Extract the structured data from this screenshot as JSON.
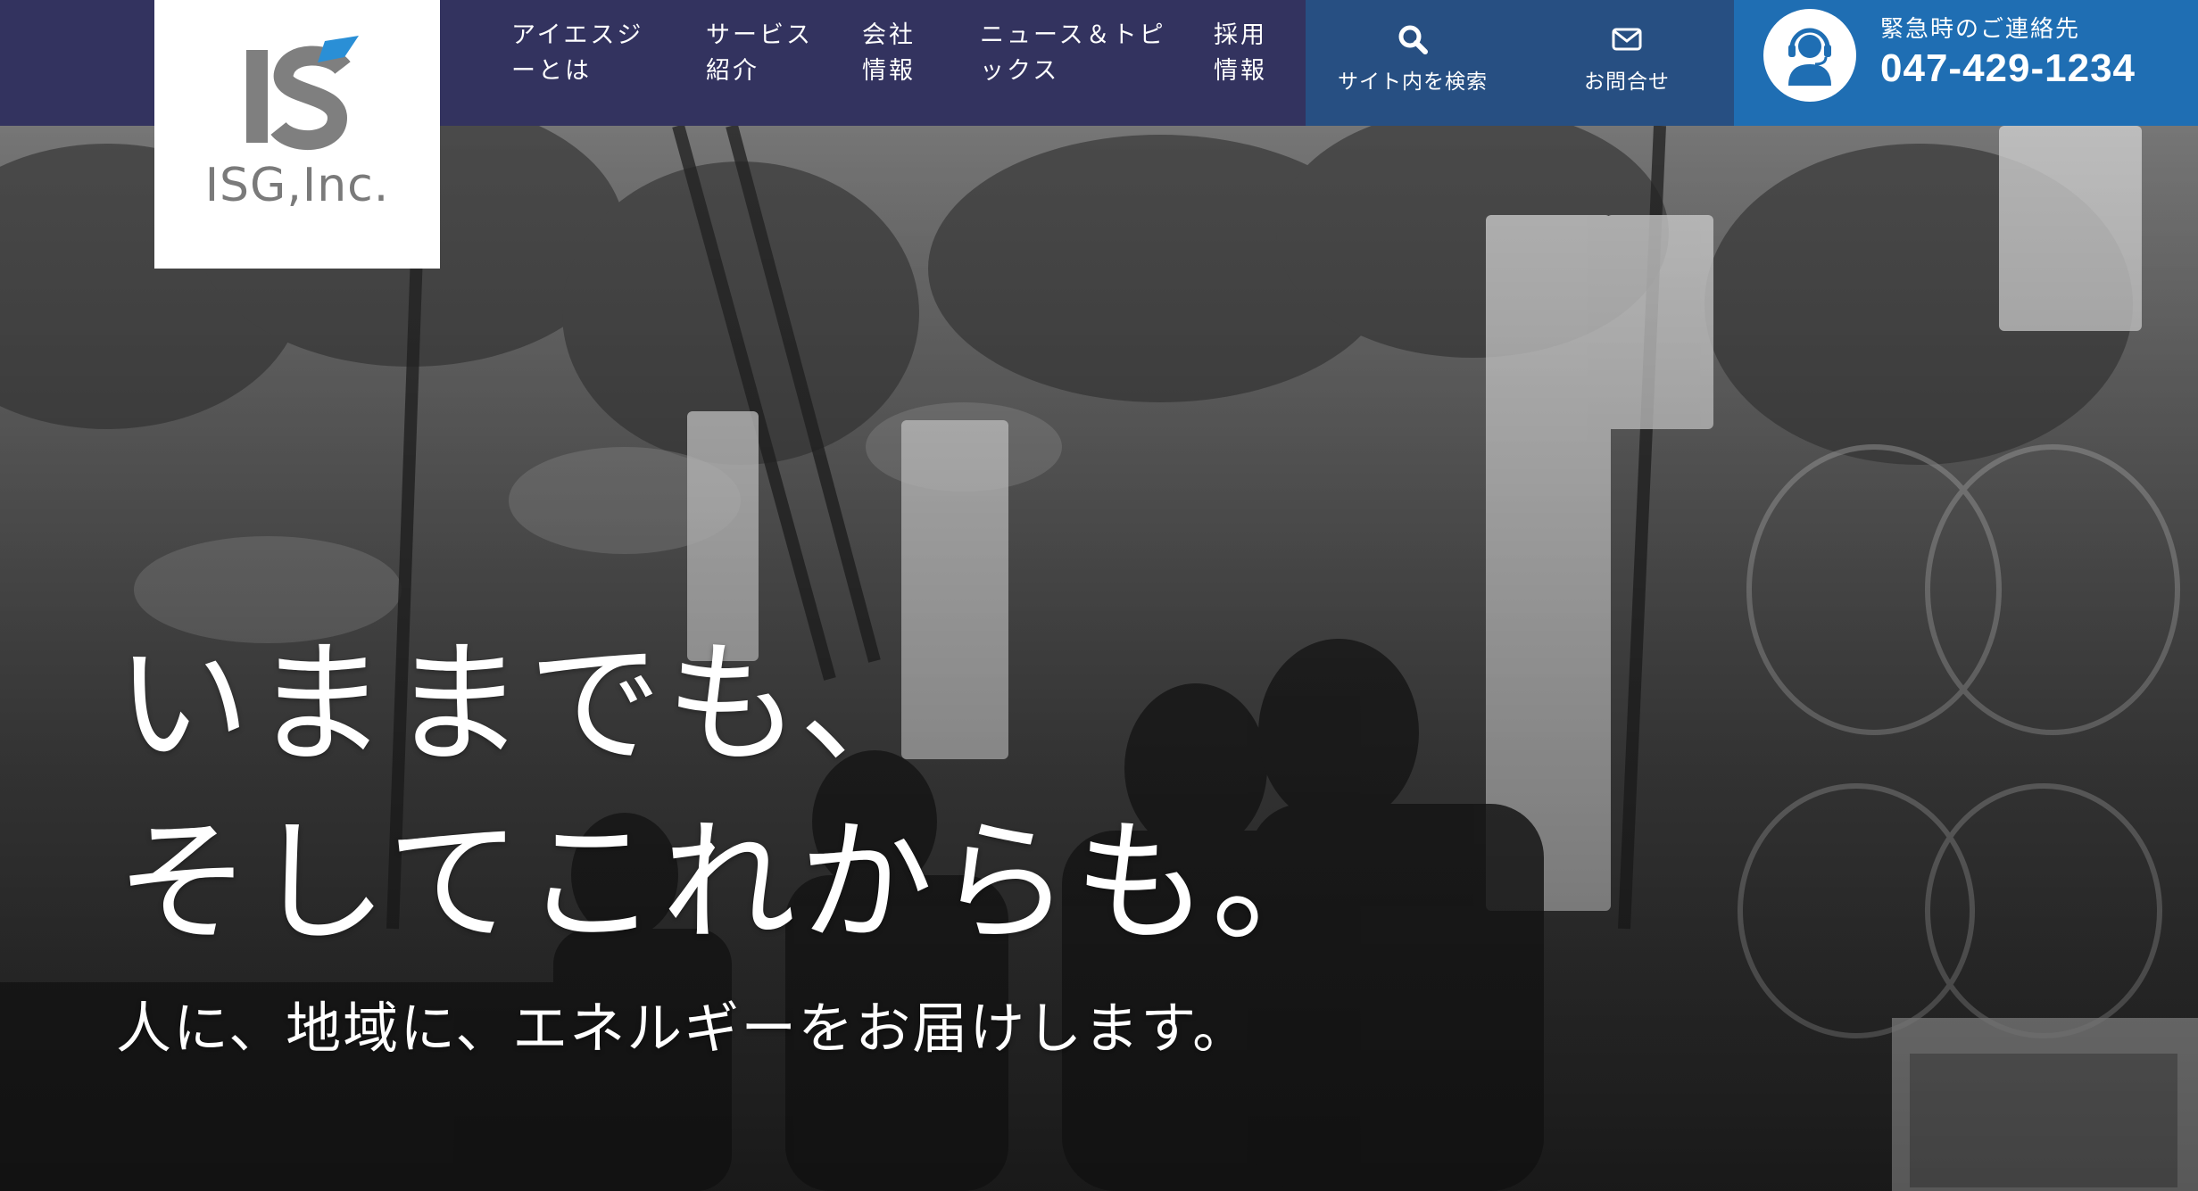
{
  "brand": {
    "logo_text": "ISG,Inc.",
    "logo_mark_letters": "IS",
    "colors": {
      "header": "#33335f",
      "utility": "#274f82",
      "emergency": "#1f6eb3"
    }
  },
  "nav": {
    "items": [
      {
        "line1": "アイエスジ",
        "line2": "ーとは"
      },
      {
        "line1": "サービス",
        "line2": "紹介"
      },
      {
        "line1": "会社",
        "line2": "情報"
      },
      {
        "line1": "ニュース＆トピ",
        "line2": "ックス"
      },
      {
        "line1": "採用",
        "line2": "情報"
      }
    ]
  },
  "utility": {
    "search": {
      "label": "サイト内を検索",
      "icon": "search-icon"
    },
    "contact": {
      "label": "お問合せ",
      "icon": "envelope-icon"
    }
  },
  "emergency": {
    "label": "緊急時のご連絡先",
    "phone": "047-429-1234",
    "icon": "operator-headset-icon"
  },
  "hero": {
    "headline_line1": "いままでも、",
    "headline_line2": "そしてこれからも。",
    "tagline": "人に、地域に、エネルギーをお届けします。"
  }
}
